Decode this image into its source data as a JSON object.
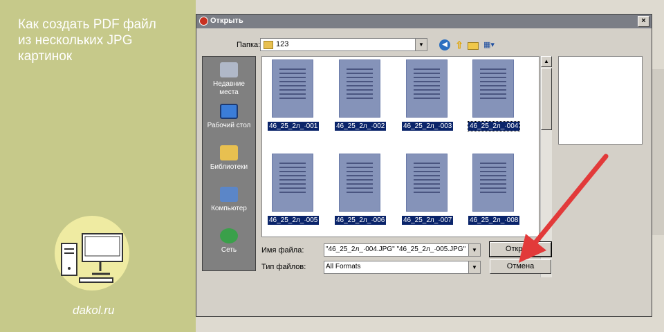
{
  "article": {
    "title_lines": [
      "Как создать PDF файл",
      "из нескольких JPG",
      "картинок"
    ],
    "site": "dakol.ru",
    "colors": {
      "left_panel": "#c6c98a",
      "logo_circle": "#efeba2",
      "arrow": "#e23a3a"
    }
  },
  "dialog": {
    "title": "Открыть",
    "close_label": "×",
    "folder_label": "Папка:",
    "folder_value": "123",
    "toolbar_icons": [
      "back-icon",
      "up-folder-icon",
      "new-folder-icon",
      "view-menu-icon"
    ],
    "places": [
      {
        "label": "Недавние места",
        "icon": "recent-places-icon"
      },
      {
        "label": "Рабочий стол",
        "icon": "desktop-icon"
      },
      {
        "label": "Библиотеки",
        "icon": "libraries-icon"
      },
      {
        "label": "Компьютер",
        "icon": "computer-icon"
      },
      {
        "label": "Сеть",
        "icon": "network-icon"
      }
    ],
    "files": [
      "46_25_2л_·001",
      "46_25_2л_·002",
      "46_25_2л_·003",
      "46_25_2л_·004",
      "46_25_2л_·005",
      "46_25_2л_·006",
      "46_25_2л_·007",
      "46_25_2л_·008"
    ],
    "filename_label": "Имя файла:",
    "filename_value": "\"46_25_2л_·004.JPG\" \"46_25_2л_·005.JPG\"",
    "filetype_label": "Тип файлов:",
    "filetype_value": "All Formats",
    "open_button": "Открыть",
    "cancel_button": "Отмена"
  }
}
